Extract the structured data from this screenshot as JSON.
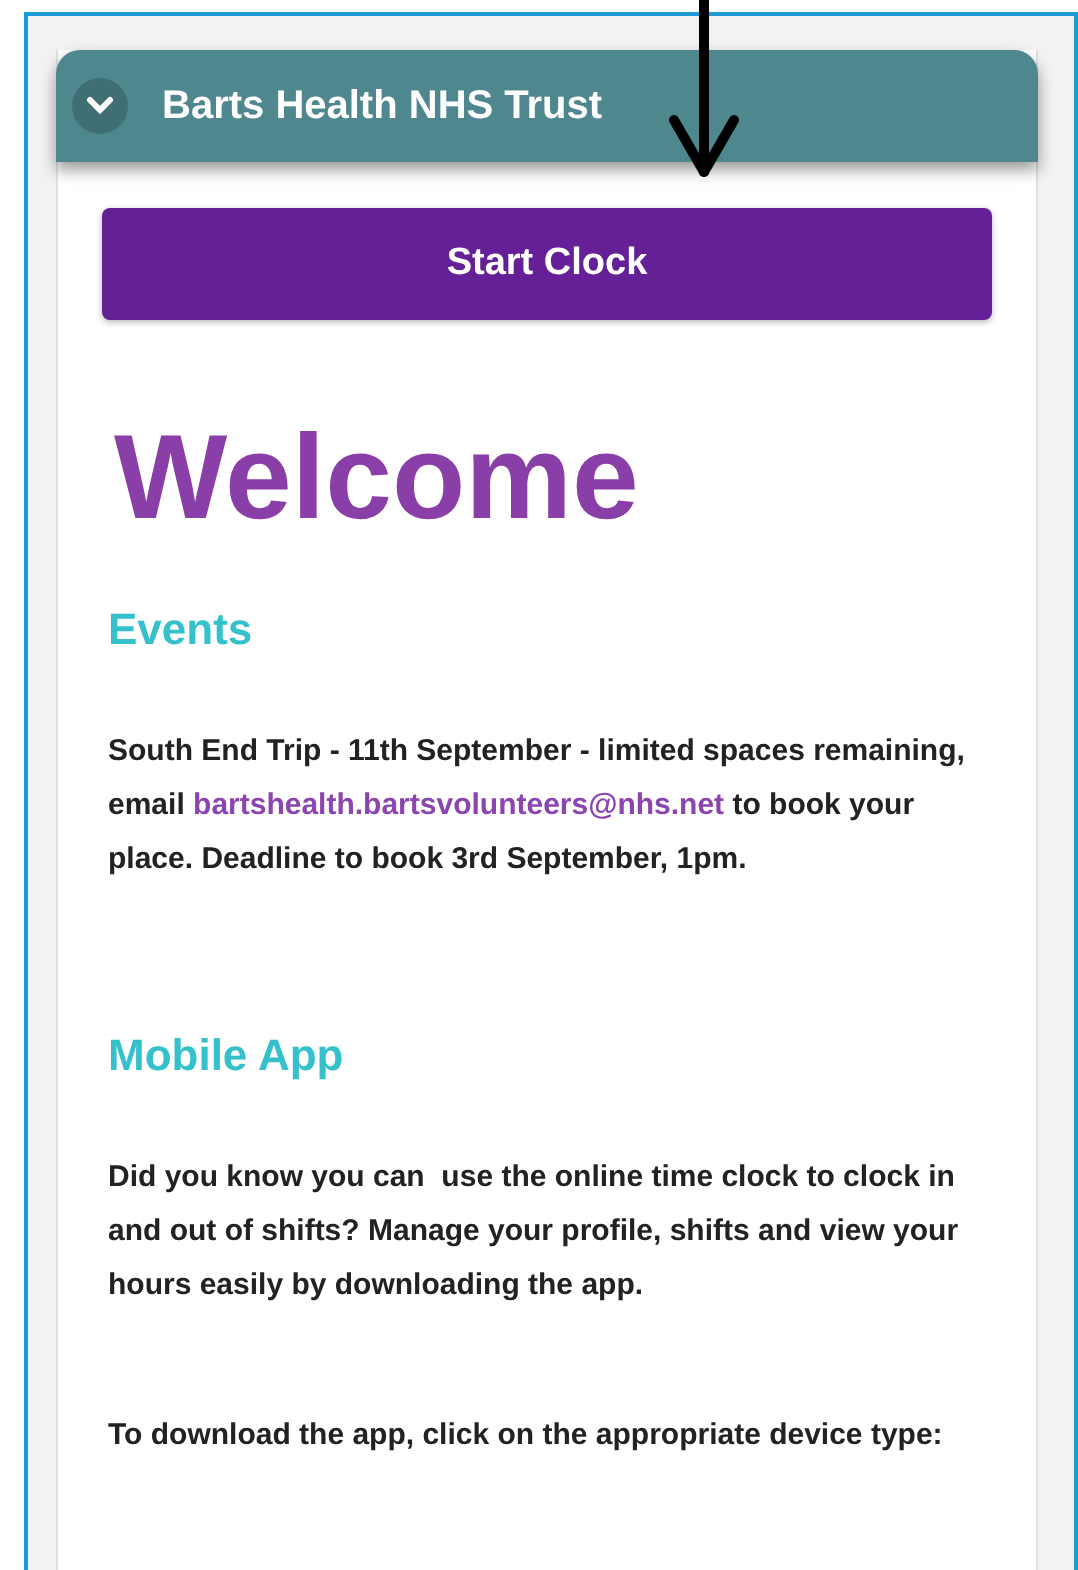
{
  "header": {
    "title": "Barts Health NHS Trust",
    "expanded": true
  },
  "start_button": {
    "label": "Start Clock"
  },
  "welcome": "Welcome",
  "sections": [
    {
      "heading": "Events",
      "paragraphs": [
        {
          "text": "South End Trip - 11th September - limited spaces remaining, email ",
          "link": "bartshealth.bartsvolunteers@nhs.net",
          "text_after": " to book your place. Deadline to book 3rd September, 1pm."
        }
      ]
    },
    {
      "heading": "Mobile App",
      "paragraphs": [
        {
          "text": "Did you know you can  use the online time clock to clock in and out of shifts? Manage your profile, shifts and view your hours easily by downloading the app."
        },
        {
          "text": "To download the app, click on the appropriate device type:"
        }
      ]
    }
  ]
}
